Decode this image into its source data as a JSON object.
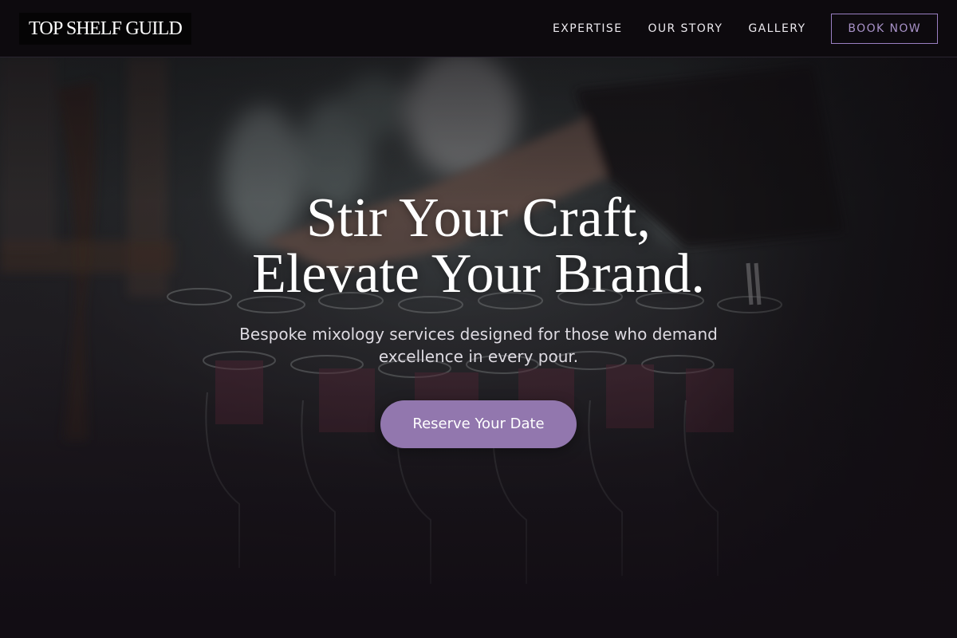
{
  "brand": {
    "logo_text": "TOP SHELF GUILD"
  },
  "nav": {
    "links": [
      {
        "label": "EXPERTISE"
      },
      {
        "label": "OUR STORY"
      },
      {
        "label": "GALLERY"
      }
    ],
    "cta_label": "BOOK NOW"
  },
  "hero": {
    "headline_line1": "Stir Your Craft,",
    "headline_line2": "Elevate Your Brand.",
    "subtext": "Bespoke mixology services designed for those who demand excellence in every pour.",
    "cta_label": "Reserve Your Date",
    "background_description": "bartender-with-glasses-photo"
  },
  "colors": {
    "accent": "#9277ae",
    "accent_border": "#9a7fc2",
    "header_bg": "#0d0a0e",
    "page_bg": "#0f0b10"
  }
}
